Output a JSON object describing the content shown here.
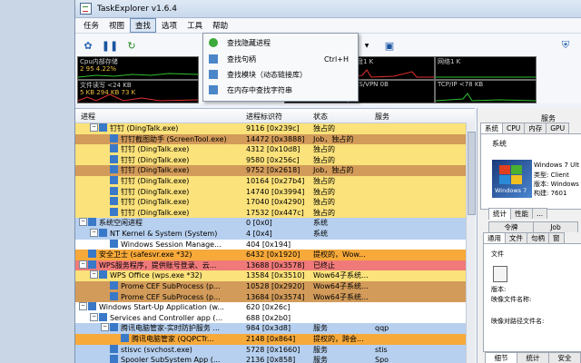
{
  "window": {
    "title": "TaskExplorer v1.6.4"
  },
  "menubar": [
    "任务",
    "视图",
    "查找",
    "选项",
    "工具",
    "帮助"
  ],
  "find_menu": [
    {
      "label": "查找隐藏进程",
      "shortcut": ""
    },
    {
      "label": "查找句柄",
      "shortcut": "Ctrl+H"
    },
    {
      "label": "查找模块（动态链接库）",
      "shortcut": ""
    },
    {
      "label": "在内存中查找字符串",
      "shortcut": ""
    }
  ],
  "gauges": [
    {
      "label": "Cpu内部存储",
      "value": "2 95 4.22%"
    },
    {
      "label": "K",
      "value": ""
    },
    {
      "label": "磁盘1 K",
      "value": ""
    },
    {
      "label": "网络1 K",
      "value": ""
    },
    {
      "label": "文件读写 <24 KB",
      "value": "5 KB 294 KB 73 K"
    },
    {
      "label": "KB",
      "value": ""
    },
    {
      "label": "RAS/VPN 0B",
      "value": ""
    },
    {
      "label": "TCP/IP <78 KB",
      "value": ""
    }
  ],
  "columns": {
    "process": "进程",
    "pid": "进程标识符",
    "status": "状态",
    "service": "服务"
  },
  "rows": [
    {
      "indent": 1,
      "exp": "−",
      "name": "钉钉 (DingTalk.exe)",
      "pid": "9116 [0x239c]",
      "status": "独占的",
      "bg": "#fbe27a"
    },
    {
      "indent": 2,
      "exp": "",
      "name": "钉钉截图助手 (ScreenTool.exe)",
      "pid": "14472 [0x3888]",
      "status": "Job，独占的",
      "bg": "#d29b5a"
    },
    {
      "indent": 2,
      "exp": "",
      "name": "钉钉 (DingTalk.exe)",
      "pid": "4312 [0x10d8]",
      "status": "独占的",
      "bg": "#fbe27a"
    },
    {
      "indent": 2,
      "exp": "",
      "name": "钉钉 (DingTalk.exe)",
      "pid": "9580 [0x256c]",
      "status": "独占的",
      "bg": "#fbe27a"
    },
    {
      "indent": 2,
      "exp": "",
      "name": "钉钉 (DingTalk.exe)",
      "pid": "9752 [0x2618]",
      "status": "Job，独占的",
      "bg": "#d29b5a"
    },
    {
      "indent": 2,
      "exp": "",
      "name": "钉钉 (DingTalk.exe)",
      "pid": "10164 [0x27b4]",
      "status": "独占的",
      "bg": "#fbe27a"
    },
    {
      "indent": 2,
      "exp": "",
      "name": "钉钉 (DingTalk.exe)",
      "pid": "14740 [0x3994]",
      "status": "独占的",
      "bg": "#fbe27a"
    },
    {
      "indent": 2,
      "exp": "",
      "name": "钉钉 (DingTalk.exe)",
      "pid": "17040 [0x4290]",
      "status": "独占的",
      "bg": "#fbe27a"
    },
    {
      "indent": 2,
      "exp": "",
      "name": "钉钉 (DingTalk.exe)",
      "pid": "17532 [0x447c]",
      "status": "独占的",
      "bg": "#fbe27a"
    },
    {
      "indent": 0,
      "exp": "−",
      "name": "系统空闲进程",
      "pid": "0 [0x0]",
      "status": "系统",
      "bg": "#b7d0ef"
    },
    {
      "indent": 1,
      "exp": "−",
      "name": "NT Kernel & System (System)",
      "pid": "4 [0x4]",
      "status": "系统",
      "bg": "#b7d0ef"
    },
    {
      "indent": 2,
      "exp": "",
      "name": "Windows Session Manage...",
      "pid": "404 [0x194]",
      "status": "",
      "bg": "#ffffff"
    },
    {
      "indent": 0,
      "exp": "",
      "name": "安全卫士 (safesvr.exe *32)",
      "pid": "6432 [0x1920]",
      "status": "提权的，Wow...",
      "bg": "#f7a93a"
    },
    {
      "indent": 0,
      "exp": "−",
      "name": "WPS服务程序，提供账号登录、云...",
      "pid": "13688 [0x3578]",
      "status": "已终止",
      "bg": "#f07a7a"
    },
    {
      "indent": 1,
      "exp": "−",
      "name": "WPS Office (wps.exe *32)",
      "pid": "13584 [0x3510]",
      "status": "Wow64子系统...",
      "bg": "#fbe27a"
    },
    {
      "indent": 2,
      "exp": "",
      "name": "Prome CEF SubProcess (p...",
      "pid": "10528 [0x2920]",
      "status": "Wow64子系统...",
      "bg": "#d29b5a"
    },
    {
      "indent": 2,
      "exp": "",
      "name": "Prome CEF SubProcess (p...",
      "pid": "13684 [0x3574]",
      "status": "Wow64子系统...",
      "bg": "#d29b5a"
    },
    {
      "indent": 0,
      "exp": "−",
      "name": "Windows Start-Up Application (w...",
      "pid": "620 [0x26c]",
      "status": "",
      "bg": "#ffffff"
    },
    {
      "indent": 1,
      "exp": "−",
      "name": "Services and Controller app (...",
      "pid": "688 [0x2b0]",
      "status": "",
      "bg": "#ffffff"
    },
    {
      "indent": 2,
      "exp": "−",
      "name": "腾讯电脑管家-实时防护服务 ...",
      "pid": "984 [0x3d8]",
      "status": "服务",
      "bg": "#b7d0ef"
    },
    {
      "indent": 3,
      "exp": "",
      "name": "腾讯电脑管家 (QQPCTr...",
      "pid": "2148 [0x864]",
      "status": "提权的，跨会...",
      "bg": "#f7a93a"
    },
    {
      "indent": 2,
      "exp": "",
      "name": "stisvc (svchost.exe)",
      "pid": "5728 [0x1660]",
      "status": "服务",
      "bg": "#b7d0ef"
    },
    {
      "indent": 2,
      "exp": "",
      "name": "Spooler SubSystem App (...",
      "pid": "2136 [0x858]",
      "status": "服务",
      "bg": "#b7d0ef"
    }
  ],
  "service_col": [
    "",
    "",
    "",
    "",
    "",
    "",
    "",
    "",
    "",
    "",
    "",
    "",
    "",
    "",
    "",
    "",
    "",
    "",
    "",
    "qqp",
    "",
    "stis",
    "Spo"
  ],
  "right": {
    "top_label": "服务",
    "top_tabs": [
      "系统",
      "CPU",
      "内存",
      "GPU"
    ],
    "sys_label": "系统",
    "win_logo": "Windows 7",
    "sysinfo": [
      "Windows 7 Ult",
      "类型: Client",
      "版本: Windows",
      "构建: 7601"
    ],
    "mid_tabs": [
      "统计",
      "性能",
      "..."
    ],
    "tabs2a": [
      "令牌",
      "Job"
    ],
    "tabs2b": [
      "通用",
      "文件",
      "句柄",
      "窗"
    ],
    "file_label": "文件",
    "new_label": "版本:",
    "img_name": "映像文件名称:",
    "img_path": "映像对路径文件名:",
    "bottom_tabs": [
      "细节",
      "统计",
      "安全"
    ]
  }
}
